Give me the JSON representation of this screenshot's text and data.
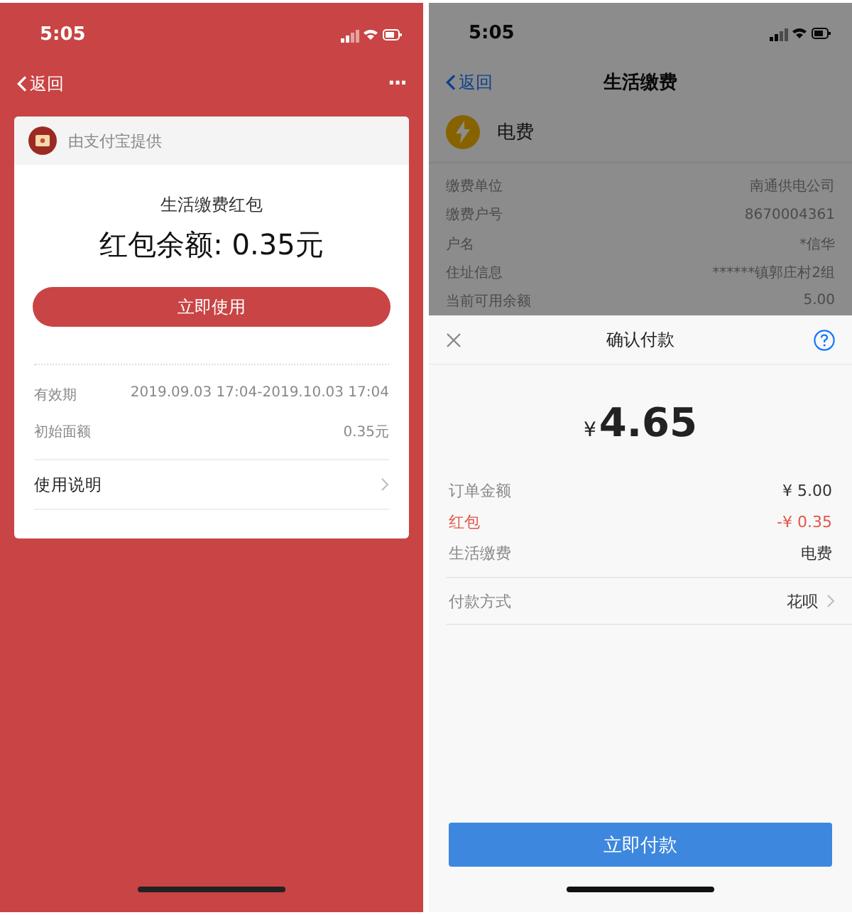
{
  "left_screen": {
    "status_bar": {
      "time": "5:05"
    },
    "nav": {
      "back": "返回",
      "more": "···"
    },
    "card": {
      "provider": "由支付宝提供",
      "title": "生活缴费红包",
      "balance": "红包余额: 0.35元",
      "use_button": "立即使用",
      "details": [
        {
          "label": "有效期",
          "value": "2019.09.03 17:04-2019.10.03 17:04"
        },
        {
          "label": "初始面额",
          "value": "0.35元"
        }
      ],
      "instructions": "使用说明"
    }
  },
  "right_screen": {
    "status_bar": {
      "time": "5:05"
    },
    "nav": {
      "back": "返回",
      "title": "生活缴费"
    },
    "service": {
      "name": "电费"
    },
    "info_rows": [
      {
        "label": "缴费单位",
        "value": "南通供电公司"
      },
      {
        "label": "缴费户号",
        "value": "8670004361"
      },
      {
        "label": "户名",
        "value": "*信华"
      },
      {
        "label": "住址信息",
        "value": "******镇郭庄村2组"
      },
      {
        "label": "当前可用余额",
        "value": "5.00"
      }
    ],
    "sheet": {
      "title": "确认付款",
      "currency": "¥",
      "amount": "4.65",
      "lines": [
        {
          "label": "订单金额",
          "value": "¥ 5.00",
          "kind": "normal"
        },
        {
          "label": "红包",
          "value": "-¥ 0.35",
          "kind": "discount"
        },
        {
          "label": "生活缴费",
          "value": "电费",
          "kind": "normal"
        }
      ],
      "method": {
        "label": "付款方式",
        "value": "花呗"
      },
      "pay_button": "立即付款"
    }
  }
}
